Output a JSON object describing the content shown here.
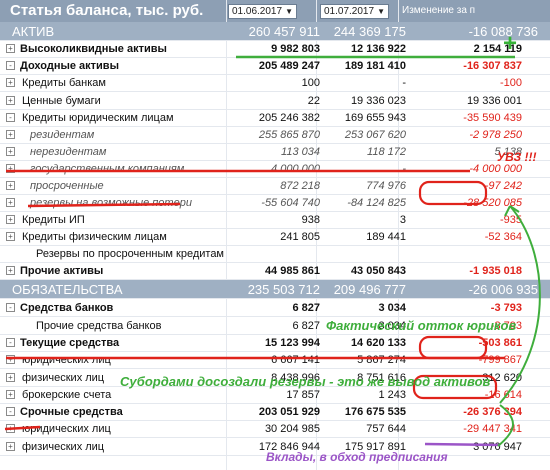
{
  "header": {
    "title": "Статья баланса, тыс. руб.",
    "date1": "01.06.2017",
    "date2": "01.07.2017",
    "change_label": "Изменение за п"
  },
  "rows": [
    {
      "label": "АКТИВ",
      "v1": "260 457 911",
      "v2": "244 369 175",
      "v3": "-16 088 736",
      "kind": "section"
    },
    {
      "label": "Высоколиквидные активы",
      "v1": "9 982 803",
      "v2": "12 136 922",
      "v3": "2 154 119",
      "kind": "bold",
      "expander": "+"
    },
    {
      "label": "Доходные активы",
      "v1": "205 489 247",
      "v2": "189 181 410",
      "v3": "-16 307 837",
      "kind": "bold",
      "expander": "-"
    },
    {
      "label": "Кредиты банкам",
      "v1": "100",
      "v2": "-",
      "v3": "-100",
      "kind": "normal",
      "expander": "+"
    },
    {
      "label": "Ценные бумаги",
      "v1": "22",
      "v2": "19 336 023",
      "v3": "19 336 001",
      "kind": "normal",
      "expander": "+"
    },
    {
      "label": "Кредиты юридическим лицам",
      "v1": "205 246 382",
      "v2": "169 655 943",
      "v3": "-35 590 439",
      "kind": "normal",
      "expander": "-"
    },
    {
      "label": "резидентам",
      "v1": "255 865 870",
      "v2": "253 067 620",
      "v3": "-2 978 250",
      "kind": "italic",
      "expander": "+"
    },
    {
      "label": "нерезидентам",
      "v1": "113 034",
      "v2": "118 172",
      "v3": "5 138",
      "kind": "italic",
      "expander": "+"
    },
    {
      "label": "государственным компаниям",
      "v1": "4 000 000",
      "v2": "-",
      "v3": "-4 000 000",
      "kind": "italic",
      "expander": "+"
    },
    {
      "label": "просроченные",
      "v1": "872 218",
      "v2": "774 976",
      "v3": "-97 242",
      "kind": "italic",
      "expander": "+"
    },
    {
      "label": "резервы на возможные потери",
      "v1": "-55 604 740",
      "v2": "-84 124 825",
      "v3": "-28 520 085",
      "kind": "italic",
      "expander": "+"
    },
    {
      "label": "Кредиты ИП",
      "v1": "938",
      "v2": "3",
      "v3": "-935",
      "kind": "normal",
      "expander": "+"
    },
    {
      "label": "Кредиты физическим лицам",
      "v1": "241 805",
      "v2": "189 441",
      "v3": "-52 364",
      "kind": "normal",
      "expander": "+"
    },
    {
      "label": "Резервы по просроченным кредитам",
      "v1": "",
      "v2": "",
      "v3": "",
      "kind": "normal",
      "expander": ""
    },
    {
      "label": "Прочие активы",
      "v1": "44 985 861",
      "v2": "43 050 843",
      "v3": "-1 935 018",
      "kind": "bold",
      "expander": "+"
    },
    {
      "label": "ОБЯЗАТЕЛЬСТВА",
      "v1": "235 503 712",
      "v2": "209 496 777",
      "v3": "-26 006 935",
      "kind": "section"
    },
    {
      "label": "Средства банков",
      "v1": "6 827",
      "v2": "3 034",
      "v3": "-3 793",
      "kind": "bold",
      "expander": "-"
    },
    {
      "label": "Прочие средства банков",
      "v1": "6 827",
      "v2": "3 034",
      "v3": "-3 793",
      "kind": "normal",
      "expander": ""
    },
    {
      "label": "Текущие средства",
      "v1": "15 123 994",
      "v2": "14 620 133",
      "v3": "-503 861",
      "kind": "bold",
      "expander": "-"
    },
    {
      "label": "юридических лиц",
      "v1": "6 667 141",
      "v2": "5 867 274",
      "v3": "-799 867",
      "kind": "normal",
      "expander": "+"
    },
    {
      "label": "физических лиц",
      "v1": "8 438 996",
      "v2": "8 751 616",
      "v3": "312 620",
      "kind": "normal",
      "expander": "+"
    },
    {
      "label": "брокерские счета",
      "v1": "17 857",
      "v2": "1 243",
      "v3": "-16 614",
      "kind": "normal",
      "expander": "+"
    },
    {
      "label": "Срочные средства",
      "v1": "203 051 929",
      "v2": "176 675 535",
      "v3": "-26 376 394",
      "kind": "bold",
      "expander": "-"
    },
    {
      "label": "юридических лиц",
      "v1": "30 204 985",
      "v2": "757 644",
      "v3": "-29 447 341",
      "kind": "normal",
      "expander": "+"
    },
    {
      "label": "физических лиц",
      "v1": "172 846 944",
      "v2": "175 917 891",
      "v3": "3 070 947",
      "kind": "normal",
      "expander": "+"
    }
  ],
  "annotations": {
    "plus": "+",
    "uvz": "УВЗ !!!",
    "outflow": "Фактический отток юриков",
    "subordinated": "Субордами досоздали резервы - это же вывод активов",
    "deposits": "Вклады, в обход предписания"
  },
  "colors": {
    "header_bg": "#8d9fb4",
    "section_bg": "#9fb0c3",
    "negative": "#e0231b",
    "annotation_green": "#3fae3c",
    "annotation_red": "#e0231b",
    "annotation_purple": "#9b55c7"
  }
}
